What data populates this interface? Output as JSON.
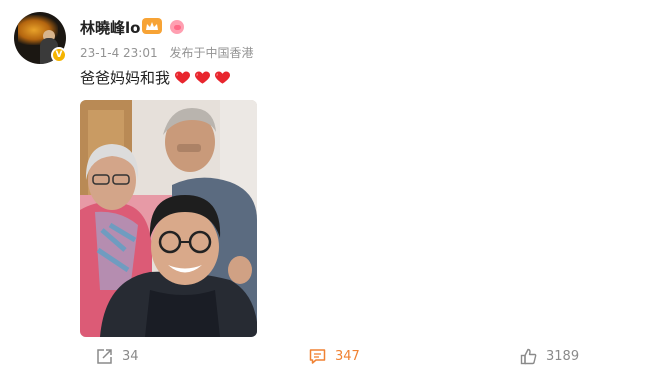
{
  "post": {
    "author_name": "林曉峰lo",
    "timestamp": "23-1-4 23:01",
    "location_prefix": "发布于",
    "location": "中国香港",
    "text": "爸爸妈妈和我",
    "hearts": [
      "heart",
      "heart",
      "heart"
    ],
    "verified_badge": "V",
    "photo_subject": "family-photo"
  },
  "actions": {
    "repost_count": "34",
    "comment_count": "347",
    "like_count": "3189"
  },
  "colors": {
    "accent_orange": "#f08233",
    "verified_gold": "#f5b400",
    "meta_gray": "#939393",
    "heart_red": "#e8262e"
  },
  "icons": {
    "repost": "repost-icon",
    "comment": "comment-icon",
    "like": "like-icon",
    "crown": "crown-icon",
    "pig": "pig-icon"
  }
}
